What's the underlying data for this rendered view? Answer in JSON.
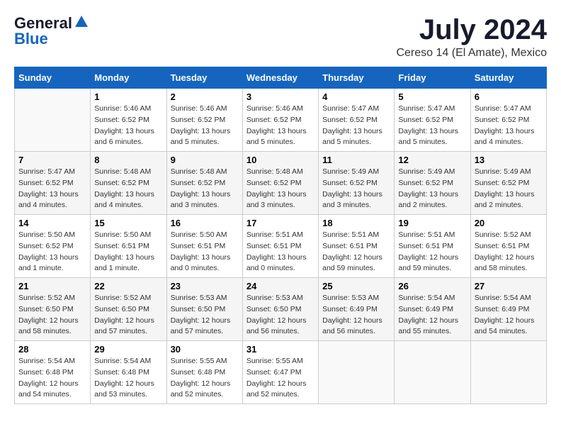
{
  "header": {
    "logo_line1": "General",
    "logo_line2": "Blue",
    "title": "July 2024",
    "subtitle": "Cereso 14 (El Amate), Mexico"
  },
  "calendar": {
    "headers": [
      "Sunday",
      "Monday",
      "Tuesday",
      "Wednesday",
      "Thursday",
      "Friday",
      "Saturday"
    ],
    "weeks": [
      [
        {
          "day": "",
          "sunrise": "",
          "sunset": "",
          "daylight": ""
        },
        {
          "day": "1",
          "sunrise": "Sunrise: 5:46 AM",
          "sunset": "Sunset: 6:52 PM",
          "daylight": "Daylight: 13 hours and 6 minutes."
        },
        {
          "day": "2",
          "sunrise": "Sunrise: 5:46 AM",
          "sunset": "Sunset: 6:52 PM",
          "daylight": "Daylight: 13 hours and 5 minutes."
        },
        {
          "day": "3",
          "sunrise": "Sunrise: 5:46 AM",
          "sunset": "Sunset: 6:52 PM",
          "daylight": "Daylight: 13 hours and 5 minutes."
        },
        {
          "day": "4",
          "sunrise": "Sunrise: 5:47 AM",
          "sunset": "Sunset: 6:52 PM",
          "daylight": "Daylight: 13 hours and 5 minutes."
        },
        {
          "day": "5",
          "sunrise": "Sunrise: 5:47 AM",
          "sunset": "Sunset: 6:52 PM",
          "daylight": "Daylight: 13 hours and 5 minutes."
        },
        {
          "day": "6",
          "sunrise": "Sunrise: 5:47 AM",
          "sunset": "Sunset: 6:52 PM",
          "daylight": "Daylight: 13 hours and 4 minutes."
        }
      ],
      [
        {
          "day": "7",
          "sunrise": "Sunrise: 5:47 AM",
          "sunset": "Sunset: 6:52 PM",
          "daylight": "Daylight: 13 hours and 4 minutes."
        },
        {
          "day": "8",
          "sunrise": "Sunrise: 5:48 AM",
          "sunset": "Sunset: 6:52 PM",
          "daylight": "Daylight: 13 hours and 4 minutes."
        },
        {
          "day": "9",
          "sunrise": "Sunrise: 5:48 AM",
          "sunset": "Sunset: 6:52 PM",
          "daylight": "Daylight: 13 hours and 3 minutes."
        },
        {
          "day": "10",
          "sunrise": "Sunrise: 5:48 AM",
          "sunset": "Sunset: 6:52 PM",
          "daylight": "Daylight: 13 hours and 3 minutes."
        },
        {
          "day": "11",
          "sunrise": "Sunrise: 5:49 AM",
          "sunset": "Sunset: 6:52 PM",
          "daylight": "Daylight: 13 hours and 3 minutes."
        },
        {
          "day": "12",
          "sunrise": "Sunrise: 5:49 AM",
          "sunset": "Sunset: 6:52 PM",
          "daylight": "Daylight: 13 hours and 2 minutes."
        },
        {
          "day": "13",
          "sunrise": "Sunrise: 5:49 AM",
          "sunset": "Sunset: 6:52 PM",
          "daylight": "Daylight: 13 hours and 2 minutes."
        }
      ],
      [
        {
          "day": "14",
          "sunrise": "Sunrise: 5:50 AM",
          "sunset": "Sunset: 6:52 PM",
          "daylight": "Daylight: 13 hours and 1 minute."
        },
        {
          "day": "15",
          "sunrise": "Sunrise: 5:50 AM",
          "sunset": "Sunset: 6:51 PM",
          "daylight": "Daylight: 13 hours and 1 minute."
        },
        {
          "day": "16",
          "sunrise": "Sunrise: 5:50 AM",
          "sunset": "Sunset: 6:51 PM",
          "daylight": "Daylight: 13 hours and 0 minutes."
        },
        {
          "day": "17",
          "sunrise": "Sunrise: 5:51 AM",
          "sunset": "Sunset: 6:51 PM",
          "daylight": "Daylight: 13 hours and 0 minutes."
        },
        {
          "day": "18",
          "sunrise": "Sunrise: 5:51 AM",
          "sunset": "Sunset: 6:51 PM",
          "daylight": "Daylight: 12 hours and 59 minutes."
        },
        {
          "day": "19",
          "sunrise": "Sunrise: 5:51 AM",
          "sunset": "Sunset: 6:51 PM",
          "daylight": "Daylight: 12 hours and 59 minutes."
        },
        {
          "day": "20",
          "sunrise": "Sunrise: 5:52 AM",
          "sunset": "Sunset: 6:51 PM",
          "daylight": "Daylight: 12 hours and 58 minutes."
        }
      ],
      [
        {
          "day": "21",
          "sunrise": "Sunrise: 5:52 AM",
          "sunset": "Sunset: 6:50 PM",
          "daylight": "Daylight: 12 hours and 58 minutes."
        },
        {
          "day": "22",
          "sunrise": "Sunrise: 5:52 AM",
          "sunset": "Sunset: 6:50 PM",
          "daylight": "Daylight: 12 hours and 57 minutes."
        },
        {
          "day": "23",
          "sunrise": "Sunrise: 5:53 AM",
          "sunset": "Sunset: 6:50 PM",
          "daylight": "Daylight: 12 hours and 57 minutes."
        },
        {
          "day": "24",
          "sunrise": "Sunrise: 5:53 AM",
          "sunset": "Sunset: 6:50 PM",
          "daylight": "Daylight: 12 hours and 56 minutes."
        },
        {
          "day": "25",
          "sunrise": "Sunrise: 5:53 AM",
          "sunset": "Sunset: 6:49 PM",
          "daylight": "Daylight: 12 hours and 56 minutes."
        },
        {
          "day": "26",
          "sunrise": "Sunrise: 5:54 AM",
          "sunset": "Sunset: 6:49 PM",
          "daylight": "Daylight: 12 hours and 55 minutes."
        },
        {
          "day": "27",
          "sunrise": "Sunrise: 5:54 AM",
          "sunset": "Sunset: 6:49 PM",
          "daylight": "Daylight: 12 hours and 54 minutes."
        }
      ],
      [
        {
          "day": "28",
          "sunrise": "Sunrise: 5:54 AM",
          "sunset": "Sunset: 6:48 PM",
          "daylight": "Daylight: 12 hours and 54 minutes."
        },
        {
          "day": "29",
          "sunrise": "Sunrise: 5:54 AM",
          "sunset": "Sunset: 6:48 PM",
          "daylight": "Daylight: 12 hours and 53 minutes."
        },
        {
          "day": "30",
          "sunrise": "Sunrise: 5:55 AM",
          "sunset": "Sunset: 6:48 PM",
          "daylight": "Daylight: 12 hours and 52 minutes."
        },
        {
          "day": "31",
          "sunrise": "Sunrise: 5:55 AM",
          "sunset": "Sunset: 6:47 PM",
          "daylight": "Daylight: 12 hours and 52 minutes."
        },
        {
          "day": "",
          "sunrise": "",
          "sunset": "",
          "daylight": ""
        },
        {
          "day": "",
          "sunrise": "",
          "sunset": "",
          "daylight": ""
        },
        {
          "day": "",
          "sunrise": "",
          "sunset": "",
          "daylight": ""
        }
      ]
    ]
  }
}
